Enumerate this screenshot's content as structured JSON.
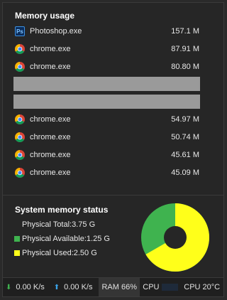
{
  "memory_usage": {
    "title": "Memory usage",
    "processes": [
      {
        "name": "Photoshop.exe",
        "mem": "157.1 M",
        "icon": "photoshop-icon"
      },
      {
        "name": "chrome.exe",
        "mem": "87.91 M",
        "icon": "chrome-icon"
      },
      {
        "name": "chrome.exe",
        "mem": "80.80 M",
        "icon": "chrome-icon"
      },
      {
        "name": "chrome.exe",
        "mem": "54.97 M",
        "icon": "chrome-icon"
      },
      {
        "name": "chrome.exe",
        "mem": "50.74 M",
        "icon": "chrome-icon"
      },
      {
        "name": "chrome.exe",
        "mem": "45.61 M",
        "icon": "chrome-icon"
      },
      {
        "name": "chrome.exe",
        "mem": "45.09 M",
        "icon": "chrome-icon"
      }
    ]
  },
  "system_status": {
    "title": "System memory status",
    "total": "Physical Total:3.75 G",
    "available": "Physical Available:1.25 G",
    "used": "Physical Used:2.50 G",
    "available_color": "#3fb34f",
    "used_color": "#ffff1a",
    "used_fraction": 0.667
  },
  "statusbar": {
    "download": "0.00 K/s",
    "upload": "0.00 K/s",
    "ram": "RAM 66%",
    "cpu": "CPU",
    "cpu_temp": "CPU 20°C"
  }
}
